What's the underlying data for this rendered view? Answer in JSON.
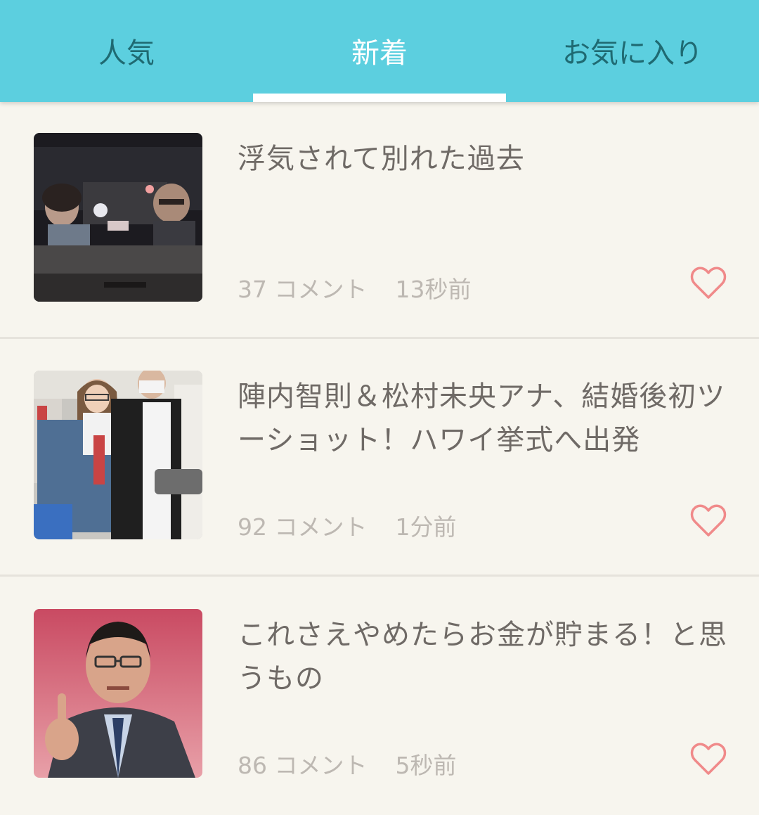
{
  "tabs": [
    {
      "label": "人気",
      "color": "#1f6a72",
      "active": false
    },
    {
      "label": "新着",
      "color": "#ffffff",
      "active": true
    },
    {
      "label": "お気に入り",
      "color": "#1f6a72",
      "active": false
    }
  ],
  "colors": {
    "header": "#5ccfdf",
    "background": "#f7f5ee",
    "title_text": "#6f6a66",
    "meta_text": "#bdb8b2",
    "heart": "#f08a8a"
  },
  "articles": [
    {
      "title": "浮気されて別れた過去",
      "comments": "37 コメント",
      "time": "13秒前",
      "thumbnail": "night-car-photo",
      "favorite_icon": "heart-outline-icon"
    },
    {
      "title": "陣内智則＆松村未央アナ、結婚後初ツーショット！ハワイ挙式へ出発",
      "comments": "92 コメント",
      "time": "1分前",
      "thumbnail": "airport-couple-photo",
      "favorite_icon": "heart-outline-icon"
    },
    {
      "title": "これさえやめたらお金が貯まる！と思うもの",
      "comments": "86 コメント",
      "time": "5秒前",
      "thumbnail": "man-pointing-photo",
      "favorite_icon": "heart-outline-icon"
    }
  ]
}
